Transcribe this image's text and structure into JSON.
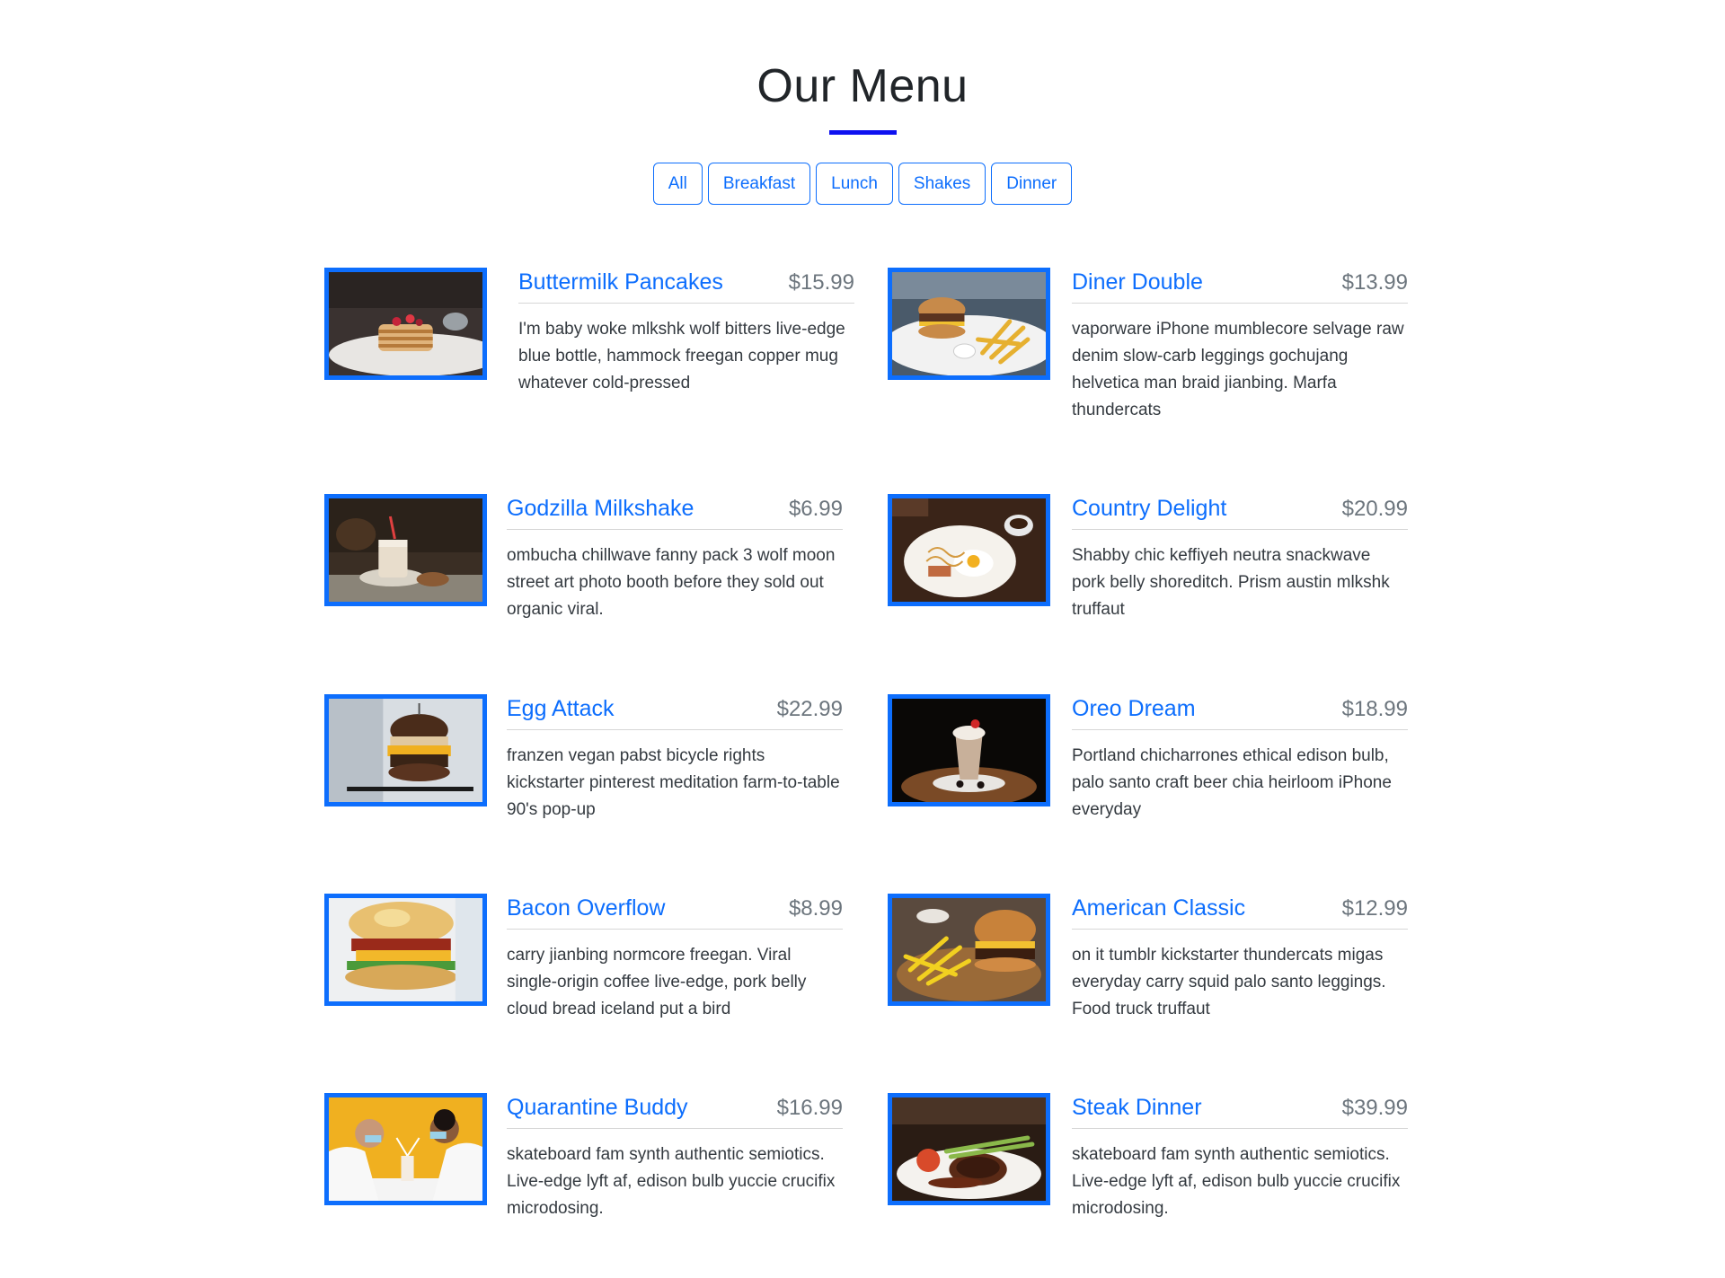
{
  "page": {
    "title": "Our Menu"
  },
  "filters": [
    "All",
    "Breakfast",
    "Lunch",
    "Shakes",
    "Dinner"
  ],
  "items": [
    {
      "name": "Buttermilk Pancakes",
      "price": "$15.99",
      "desc": "I'm baby woke mlkshk wolf bitters live-edge blue bottle, hammock freegan copper mug whatever cold-pressed",
      "image": "pancakes"
    },
    {
      "name": "Diner Double",
      "price": "$13.99",
      "desc": "vaporware iPhone mumblecore selvage raw denim slow-carb leggings gochujang helvetica man braid jianbing. Marfa thundercats",
      "image": "burger-fries"
    },
    {
      "name": "Godzilla Milkshake",
      "price": "$6.99",
      "desc": "ombucha chillwave fanny pack 3 wolf moon street art photo booth before they sold out organic viral.",
      "image": "milkshake"
    },
    {
      "name": "Country Delight",
      "price": "$20.99",
      "desc": "Shabby chic keffiyeh neutra snackwave pork belly shoreditch. Prism austin mlkshk truffaut",
      "image": "eggs-breakfast"
    },
    {
      "name": "Egg Attack",
      "price": "$22.99",
      "desc": "franzen vegan pabst bicycle rights kickstarter pinterest meditation farm-to-table 90's pop-up",
      "image": "egg-burger"
    },
    {
      "name": "Oreo Dream",
      "price": "$18.99",
      "desc": "Portland chicharrones ethical edison bulb, palo santo craft beer chia heirloom iPhone everyday",
      "image": "oreo-shake"
    },
    {
      "name": "Bacon Overflow",
      "price": "$8.99",
      "desc": "carry jianbing normcore freegan. Viral single-origin coffee live-edge, pork belly cloud bread iceland put a bird",
      "image": "bacon-biscuit"
    },
    {
      "name": "American Classic",
      "price": "$12.99",
      "desc": "on it tumblr kickstarter thundercats migas everyday carry squid palo santo leggings. Food truck truffaut",
      "image": "classic-burger"
    },
    {
      "name": "Quarantine Buddy",
      "price": "$16.99",
      "desc": "skateboard fam synth authentic semiotics. Live-edge lyft af, edison bulb yuccie crucifix microdosing.",
      "image": "quarantine-shake"
    },
    {
      "name": "Steak Dinner",
      "price": "$39.99",
      "desc": "skateboard fam synth authentic semiotics. Live-edge lyft af, edison bulb yuccie crucifix microdosing.",
      "image": "steak"
    }
  ],
  "colors": {
    "accent": "#0d6efd",
    "underline": "#0d10f0",
    "price": "#6c757d"
  }
}
